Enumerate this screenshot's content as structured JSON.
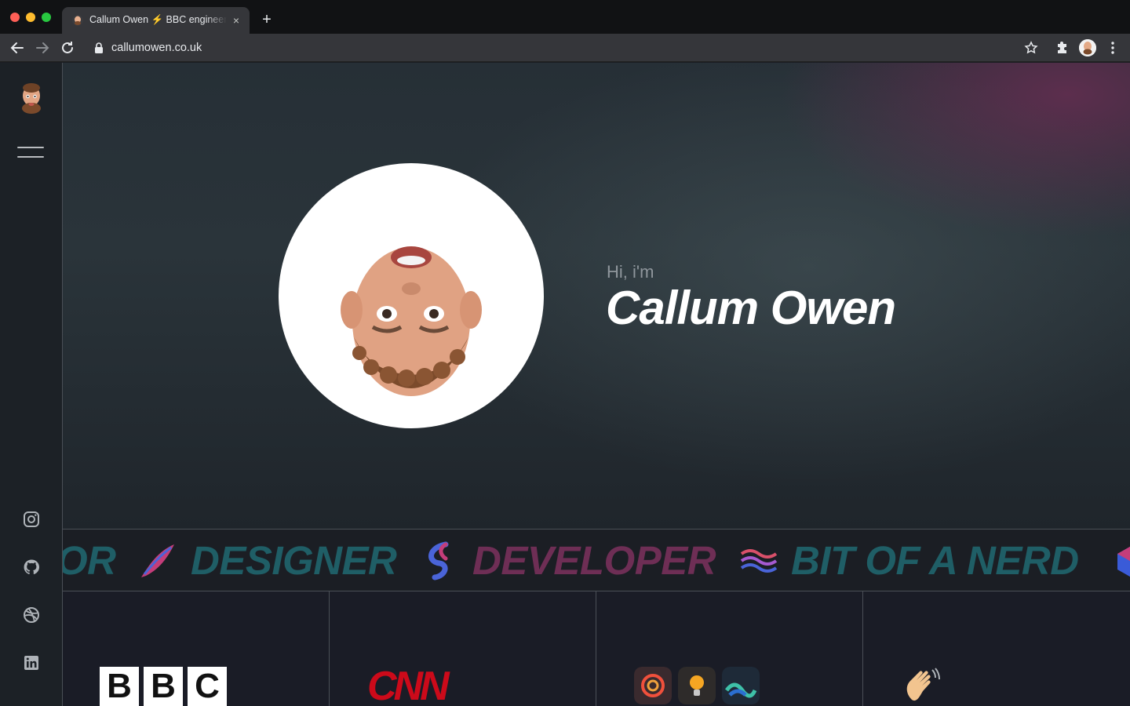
{
  "browser": {
    "tab_title": "Callum Owen ⚡ BBC engineer",
    "tab_close": "×",
    "new_tab": "+",
    "url": "callumowen.co.uk"
  },
  "sidebar": {
    "socials": [
      {
        "name": "instagram-icon"
      },
      {
        "name": "github-icon"
      },
      {
        "name": "dribbble-icon"
      },
      {
        "name": "linkedin-icon"
      }
    ]
  },
  "hero": {
    "greeting": "Hi, i'm",
    "name": "Callum Owen"
  },
  "ticker": {
    "words": [
      "OR",
      "DESIGNER",
      "DEVELOPER",
      "BIT OF A NERD"
    ]
  },
  "clients": {
    "bbc": [
      "B",
      "B",
      "C"
    ],
    "cnn": "CNN",
    "apps": [
      "app-icon-1",
      "app-icon-2",
      "app-icon-3"
    ],
    "wave": "waving-hand-emoji"
  },
  "colors": {
    "accent_teal": "#1f5e66",
    "accent_plum": "#6e2e55",
    "cnn_red": "#cc0a1a"
  }
}
